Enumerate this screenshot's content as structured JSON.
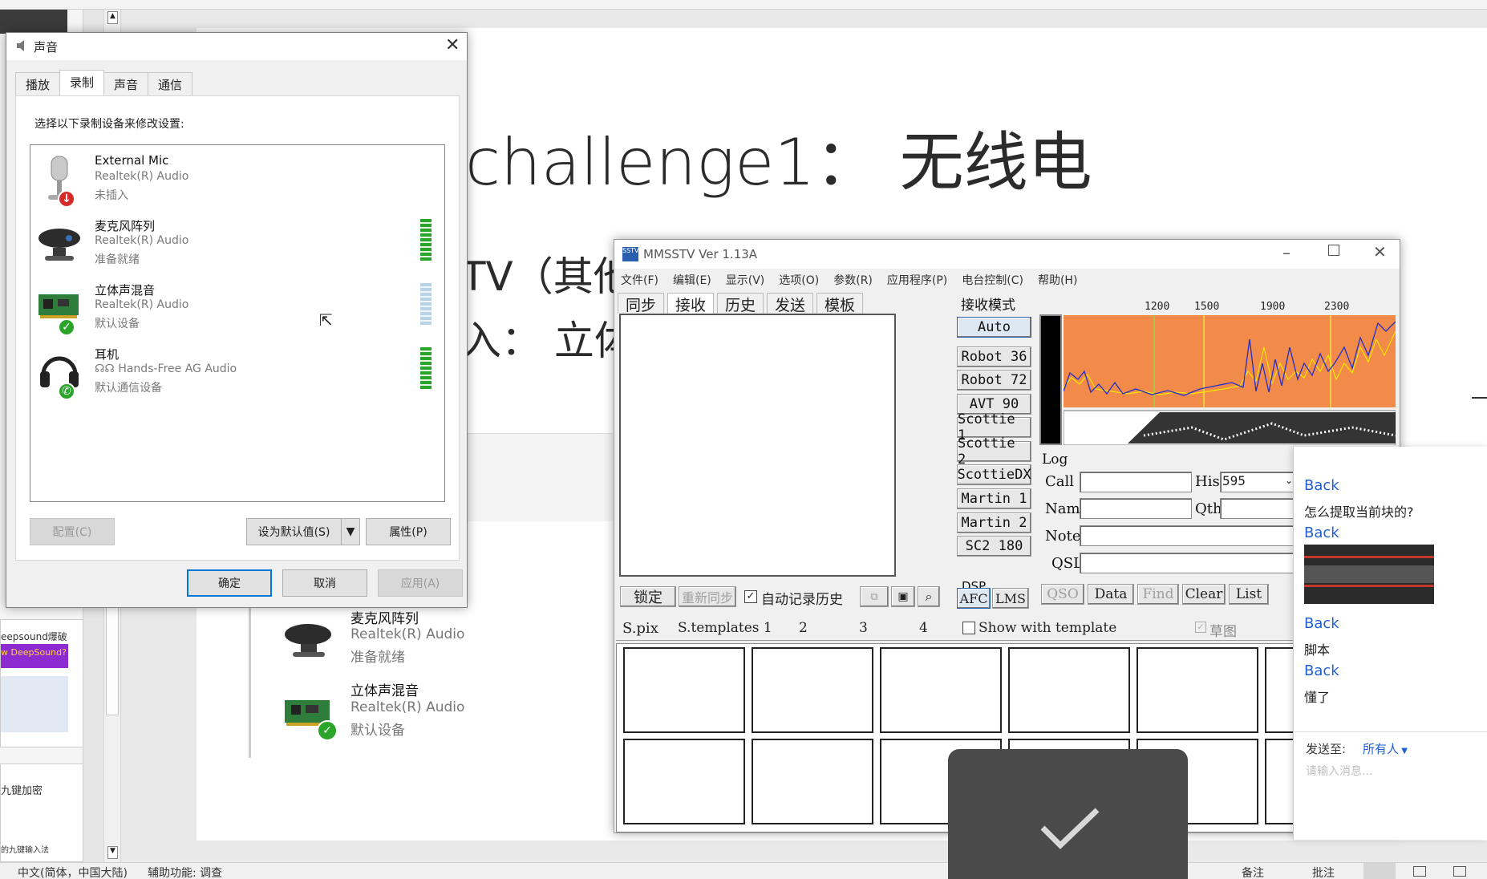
{
  "background": {
    "slide_title": "challenge1： 无线电",
    "slide_line1": "TV（其他",
    "slide_line2": "入： 立体",
    "thumb_text1": "eepsound爆破",
    "thumb_text2": "w DeepSound?",
    "thumb_text3": "九键加密",
    "thumb_text4": "的九键输入法",
    "bg_devices": [
      {
        "name": "麦克风阵列",
        "driver": "Realtek(R) Audio",
        "status": "准备就绪"
      },
      {
        "name": "立体声混音",
        "driver": "Realtek(R) Audio",
        "status": "默认设备"
      }
    ],
    "status_lang": "中文(简体，中国大陆)",
    "status_access": "辅助功能: 调查",
    "status_notes": "备注",
    "status_comments": "批注"
  },
  "sound_dialog": {
    "title": "声音",
    "tabs": [
      "播放",
      "录制",
      "声音",
      "通信"
    ],
    "active_tab": 1,
    "instruction": "选择以下录制设备来修改设置:",
    "devices": [
      {
        "name": "External Mic",
        "driver": "Realtek(R) Audio",
        "status": "未插入",
        "icon": "microphone-icon",
        "badge": "unplugged-badge-icon"
      },
      {
        "name": "麦克风阵列",
        "driver": "Realtek(R) Audio",
        "status": "准备就绪",
        "icon": "webcam-mic-icon",
        "level": 1.0
      },
      {
        "name": "立体声混音",
        "driver": "Realtek(R) Audio",
        "status": "默认设备",
        "icon": "sound-card-icon",
        "badge": "default-check-icon",
        "level": 0.0
      },
      {
        "name": "耳机",
        "driver": "Hands-Free AG Audio",
        "status": "默认通信设备",
        "icon": "headset-icon",
        "badge": "phone-badge-icon",
        "level": 1.0
      }
    ],
    "configure_label": "配置(C)",
    "set_default_label": "设为默认值(S)",
    "properties_label": "属性(P)",
    "ok_label": "确定",
    "cancel_label": "取消",
    "apply_label": "应用(A)"
  },
  "mmsstv": {
    "title": "MMSSTV Ver 1.13A",
    "menu": [
      "文件(F)",
      "编辑(E)",
      "显示(V)",
      "选项(O)",
      "参数(R)",
      "应用程序(P)",
      "电台控制(C)",
      "帮助(H)"
    ],
    "tabs": [
      "同步",
      "接收",
      "历史",
      "发送",
      "模板"
    ],
    "active_tab": 1,
    "rx_mode_label": "接收模式",
    "modes": [
      "Auto",
      "Robot 36",
      "Robot 72",
      "AVT 90",
      "Scottie 1",
      "Scottie 2",
      "ScottieDX",
      "Martin 1",
      "Martin 2",
      "SC2 180"
    ],
    "freq_ticks": [
      "1200",
      "1500",
      "1900",
      "2300"
    ],
    "log_label": "Log",
    "call_label": "Call",
    "his_label": "His",
    "his_value": "595",
    "name_label": "Name",
    "qth_label": "Qth",
    "note_label": "Note",
    "qsl_label": "QSL",
    "lock_label": "锁定",
    "resync_label": "重新同步",
    "autolog_label": "自动记录历史",
    "dsp_label": "DSP",
    "afc_label": "AFC",
    "lms_label": "LMS",
    "log_buttons": [
      "QSO",
      "Data",
      "Find",
      "Clear",
      "List"
    ],
    "bottom_tabs": [
      "S.pix",
      "S.templates 1",
      "2",
      "3",
      "4"
    ],
    "show_template_label": "Show with template",
    "draft_label": "草图"
  },
  "chat": {
    "messages": [
      {
        "back": "Back",
        "text": "怎么提取当前块的?"
      },
      {
        "back": "Back",
        "text": ""
      },
      {
        "back": "Back",
        "text": "脚本"
      },
      {
        "back": "Back",
        "text": "懂了"
      }
    ],
    "send_to_label": "发送至:",
    "send_to_value": "所有人",
    "input_placeholder": "请输入消息..."
  },
  "colors": {
    "accent": "#0078d7",
    "spectrum_bg": "#f28b4a",
    "chat_link": "#1f5fd6"
  }
}
